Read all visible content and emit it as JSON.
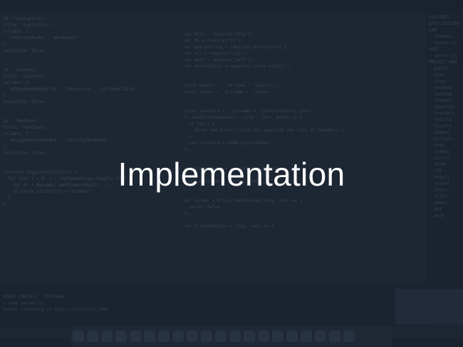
{
  "slide": {
    "title": "Implementation"
  },
  "background": {
    "left_code": "id: 'evaluation',\ntitle: 'Evaluation',\ncolumns: [\n  'internalMarks', 'marksheet'\n],\nisVisible: false\n\n\nid: 'courses',\ntitle: 'Courses',\ncolumns: [\n  'attendanceMaterial', 'Resources', 'syllabusTable'\n],\nisVisible: false\n\n\nid: 'feedback',\ntitle: 'Feedback',\ncolumns: [\n  'assignmentFeedback', 'facultyFeedback'\n],\nisVisible: false\n\n\nfunction toggleVisibility() {\n  for (var i = 0; i < tableHeadings.length; i++) {\n    var el = document.getElementById(...);\n    el.style.visibility = 'hidden';\n  }\n}",
    "center_code": "var http = require('http');\nvar fs = require('fs');\nvar querystring = require('querystring');\nvar url = require('url');\nvar path = require('path');\nvar serveStatic = require('serve-static');\n\n\nconst public = __dirname + '/public';\nconst views = __dirname + '/views';\n\n\nconst teachers = __dirname + '/data/teachers.json';\nfs.readFile(teachers, 'utf8', (err, data) => {\n  if (err) {\n    throw new Error('Could not populate the list of teachers');\n  }\n  var contents = JSON.parse(data);\n});\n\n\nvar staticServe = serveStatic(public);\n\nconst baseHtml = 'server.html';\n\n\nvar server = http.createServer((req, res) => {\n  serve: false\n});\n\nvar clientHandler = (req, res) => {\n",
    "right_panel": "EXPLORER\nOPEN EDITORS\nLAB\n  schemas\n  server.js\nBOOT\n  server.js\nPROJECT-MAN\n  public\n  data\n  views\n  backend\n  landing\n  student\n  register\n  teachers\n  results\n  faculty\n  images\n  scripts\n  base\n  common\n  errors\n  forms\n  lib\n  models\n  routes\n  tests\n  utils\n  admin\n  api\n  auth",
    "console_text": "DEBUG CONSOLE   TERMINAL\n> node server.js\nServer listening at http://localhost:3000 ..."
  }
}
